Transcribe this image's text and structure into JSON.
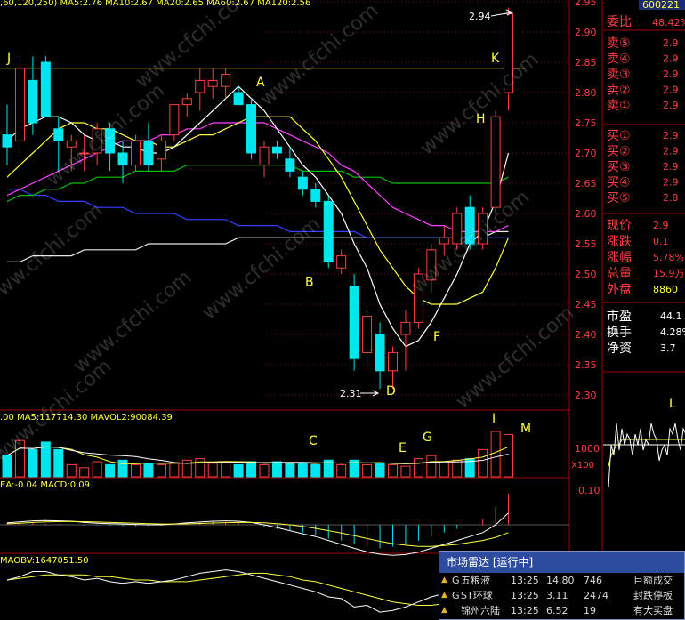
{
  "chart_data": [
    {
      "type": "candlestick",
      "title": "",
      "ylim": [
        2.28,
        2.99
      ],
      "y_ticks": [
        "2.95",
        "2.90",
        "2.85",
        "2.80",
        "2.75",
        "2.70",
        "2.65",
        "2.60",
        "2.55",
        "2.50",
        "2.45",
        "2.40",
        "2.35",
        "2.30"
      ],
      "header_text": ",60,120,250)   MA5:2.76   MA10:2.67   MA20:2.65   MA60:2.67   MA120:2.56",
      "high_label": "2.94",
      "low_label": "2.31",
      "horizontal_line": 2.84,
      "annotations": [
        "J",
        "K",
        "A",
        "H",
        "B",
        "F",
        "D"
      ],
      "candles": [
        {
          "o": 2.73,
          "h": 2.78,
          "l": 2.68,
          "c": 2.71
        },
        {
          "o": 2.72,
          "h": 2.86,
          "l": 2.7,
          "c": 2.84
        },
        {
          "o": 2.82,
          "h": 2.86,
          "l": 2.73,
          "c": 2.75
        },
        {
          "o": 2.85,
          "h": 2.86,
          "l": 2.76,
          "c": 2.76
        },
        {
          "o": 2.74,
          "h": 2.76,
          "l": 2.67,
          "c": 2.72
        },
        {
          "o": 2.71,
          "h": 2.73,
          "l": 2.67,
          "c": 2.72
        },
        {
          "o": 2.7,
          "h": 2.73,
          "l": 2.67,
          "c": 2.7
        },
        {
          "o": 2.7,
          "h": 2.75,
          "l": 2.68,
          "c": 2.74
        },
        {
          "o": 2.74,
          "h": 2.75,
          "l": 2.67,
          "c": 2.7
        },
        {
          "o": 2.7,
          "h": 2.72,
          "l": 2.65,
          "c": 2.68
        },
        {
          "o": 2.68,
          "h": 2.73,
          "l": 2.67,
          "c": 2.72
        },
        {
          "o": 2.72,
          "h": 2.75,
          "l": 2.67,
          "c": 2.68
        },
        {
          "o": 2.69,
          "h": 2.73,
          "l": 2.67,
          "c": 2.72
        },
        {
          "o": 2.73,
          "h": 2.78,
          "l": 2.72,
          "c": 2.78
        },
        {
          "o": 2.78,
          "h": 2.8,
          "l": 2.76,
          "c": 2.79
        },
        {
          "o": 2.8,
          "h": 2.84,
          "l": 2.77,
          "c": 2.82
        },
        {
          "o": 2.81,
          "h": 2.84,
          "l": 2.79,
          "c": 2.82
        },
        {
          "o": 2.81,
          "h": 2.84,
          "l": 2.79,
          "c": 2.83
        },
        {
          "o": 2.8,
          "h": 2.81,
          "l": 2.78,
          "c": 2.78
        },
        {
          "o": 2.78,
          "h": 2.79,
          "l": 2.69,
          "c": 2.7
        },
        {
          "o": 2.68,
          "h": 2.72,
          "l": 2.66,
          "c": 2.71
        },
        {
          "o": 2.71,
          "h": 2.72,
          "l": 2.69,
          "c": 2.7
        },
        {
          "o": 2.69,
          "h": 2.71,
          "l": 2.66,
          "c": 2.67
        },
        {
          "o": 2.66,
          "h": 2.67,
          "l": 2.63,
          "c": 2.64
        },
        {
          "o": 2.64,
          "h": 2.65,
          "l": 2.61,
          "c": 2.62
        },
        {
          "o": 2.62,
          "h": 2.63,
          "l": 2.51,
          "c": 2.52
        },
        {
          "o": 2.51,
          "h": 2.54,
          "l": 2.5,
          "c": 2.53
        },
        {
          "o": 2.48,
          "h": 2.5,
          "l": 2.34,
          "c": 2.36
        },
        {
          "o": 2.37,
          "h": 2.44,
          "l": 2.35,
          "c": 2.43
        },
        {
          "o": 2.4,
          "h": 2.42,
          "l": 2.31,
          "c": 2.34
        },
        {
          "o": 2.34,
          "h": 2.38,
          "l": 2.31,
          "c": 2.37
        },
        {
          "o": 2.4,
          "h": 2.44,
          "l": 2.34,
          "c": 2.42
        },
        {
          "o": 2.42,
          "h": 2.51,
          "l": 2.41,
          "c": 2.5
        },
        {
          "o": 2.49,
          "h": 2.55,
          "l": 2.47,
          "c": 2.54
        },
        {
          "o": 2.55,
          "h": 2.58,
          "l": 2.53,
          "c": 2.56
        },
        {
          "o": 2.55,
          "h": 2.61,
          "l": 2.54,
          "c": 2.6
        },
        {
          "o": 2.61,
          "h": 2.63,
          "l": 2.54,
          "c": 2.55
        },
        {
          "o": 2.55,
          "h": 2.61,
          "l": 2.54,
          "c": 2.6
        },
        {
          "o": 2.61,
          "h": 2.77,
          "l": 2.6,
          "c": 2.76
        },
        {
          "o": 2.8,
          "h": 2.94,
          "l": 2.77,
          "c": 2.93
        }
      ],
      "ma": {
        "MA5": [
          2.72,
          2.74,
          2.75,
          2.76,
          2.76,
          2.75,
          2.73,
          2.72,
          2.72,
          2.71,
          2.71,
          2.7,
          2.7,
          2.71,
          2.73,
          2.75,
          2.77,
          2.79,
          2.81,
          2.79,
          2.77,
          2.74,
          2.71,
          2.68,
          2.66,
          2.63,
          2.6,
          2.55,
          2.51,
          2.45,
          2.41,
          2.38,
          2.39,
          2.42,
          2.46,
          2.5,
          2.55,
          2.57,
          2.62,
          2.7
        ],
        "MA10": [
          2.66,
          2.68,
          2.7,
          2.72,
          2.74,
          2.75,
          2.75,
          2.74,
          2.74,
          2.73,
          2.72,
          2.72,
          2.71,
          2.71,
          2.72,
          2.73,
          2.73,
          2.74,
          2.75,
          2.76,
          2.76,
          2.76,
          2.76,
          2.74,
          2.72,
          2.69,
          2.66,
          2.62,
          2.58,
          2.54,
          2.51,
          2.48,
          2.46,
          2.45,
          2.45,
          2.45,
          2.46,
          2.47,
          2.51,
          2.56
        ],
        "MA20": [
          2.63,
          2.64,
          2.65,
          2.66,
          2.67,
          2.68,
          2.69,
          2.7,
          2.71,
          2.72,
          2.72,
          2.72,
          2.73,
          2.73,
          2.74,
          2.74,
          2.75,
          2.75,
          2.75,
          2.75,
          2.75,
          2.74,
          2.73,
          2.72,
          2.71,
          2.7,
          2.68,
          2.67,
          2.65,
          2.63,
          2.61,
          2.6,
          2.59,
          2.58,
          2.58,
          2.57,
          2.57,
          2.57,
          2.57,
          2.58
        ],
        "MA60": [
          2.62,
          2.63,
          2.63,
          2.64,
          2.64,
          2.65,
          2.65,
          2.66,
          2.66,
          2.66,
          2.67,
          2.67,
          2.67,
          2.67,
          2.68,
          2.68,
          2.68,
          2.68,
          2.68,
          2.68,
          2.68,
          2.68,
          2.68,
          2.67,
          2.67,
          2.67,
          2.67,
          2.66,
          2.66,
          2.66,
          2.65,
          2.65,
          2.65,
          2.65,
          2.65,
          2.65,
          2.65,
          2.65,
          2.65,
          2.66
        ],
        "MA120": [
          2.64,
          2.64,
          2.63,
          2.63,
          2.62,
          2.62,
          2.62,
          2.61,
          2.61,
          2.61,
          2.6,
          2.6,
          2.6,
          2.6,
          2.59,
          2.59,
          2.59,
          2.59,
          2.58,
          2.58,
          2.58,
          2.58,
          2.57,
          2.57,
          2.57,
          2.57,
          2.57,
          2.57,
          2.56,
          2.56,
          2.56,
          2.56,
          2.56,
          2.56,
          2.56,
          2.56,
          2.56,
          2.56,
          2.56,
          2.56
        ],
        "MA250": [
          2.52,
          2.52,
          2.53,
          2.53,
          2.53,
          2.53,
          2.54,
          2.54,
          2.54,
          2.54,
          2.54,
          2.55,
          2.55,
          2.55,
          2.55,
          2.55,
          2.55,
          2.55,
          2.56,
          2.56,
          2.56,
          2.56,
          2.56,
          2.56,
          2.56,
          2.56,
          2.56,
          2.56,
          2.56,
          2.56,
          2.56,
          2.56,
          2.56,
          2.56,
          2.56,
          2.56,
          2.56,
          2.56,
          2.57,
          2.57
        ]
      },
      "colors": {
        "up": "#ff4040",
        "down": "#00e5ee",
        "MA5": "#ffffff",
        "MA10": "#ffff40",
        "MA20": "#ff40ff",
        "MA60": "#00c000",
        "MA120": "#3040ff",
        "MA250": "#e8e8e8",
        "hline": "#c8c800"
      }
    },
    {
      "type": "bar",
      "title": "VOL",
      "header_text": ".00   MA5:117714.30   MAVOL2:90084.39",
      "y_tick": "1000",
      "y_unit": "X100",
      "annotations": [
        "C",
        "E",
        "G",
        "I",
        "M"
      ],
      "values": [
        70,
        120,
        90,
        115,
        90,
        40,
        30,
        50,
        40,
        55,
        40,
        45,
        40,
        45,
        55,
        60,
        45,
        50,
        40,
        50,
        40,
        50,
        45,
        45,
        40,
        55,
        40,
        55,
        40,
        45,
        40,
        35,
        60,
        70,
        50,
        55,
        60,
        90,
        150,
        140
      ],
      "colors": {
        "up": "#ff4040",
        "down": "#00e5ee",
        "ma": "#ffff40",
        "ma2": "#ffffff"
      }
    },
    {
      "type": "macd",
      "header_text": "EA:-0.04   MACD:0.09",
      "y_tick": "0.10",
      "values": [
        0.01,
        0.012,
        0.01,
        0.006,
        0.004,
        0.0,
        -0.004,
        -0.003,
        -0.004,
        -0.006,
        -0.006,
        -0.007,
        -0.004,
        0.004,
        0.01,
        0.016,
        0.018,
        0.016,
        0.01,
        0.0,
        -0.01,
        -0.02,
        -0.03,
        -0.04,
        -0.05,
        -0.07,
        -0.08,
        -0.1,
        -0.11,
        -0.12,
        -0.11,
        -0.1,
        -0.08,
        -0.06,
        -0.04,
        -0.02,
        0.0,
        0.03,
        0.09,
        0.16
      ],
      "dif": [
        0.01,
        0.015,
        0.02,
        0.022,
        0.02,
        0.018,
        0.012,
        0.008,
        0.006,
        0.004,
        0.002,
        0.0,
        0.0,
        0.004,
        0.01,
        0.014,
        0.018,
        0.02,
        0.018,
        0.012,
        0.0,
        -0.014,
        -0.03,
        -0.046,
        -0.06,
        -0.08,
        -0.1,
        -0.12,
        -0.138,
        -0.15,
        -0.156,
        -0.152,
        -0.14,
        -0.12,
        -0.1,
        -0.08,
        -0.06,
        -0.04,
        0.0,
        0.06
      ],
      "dea": [
        0.005,
        0.008,
        0.012,
        0.015,
        0.016,
        0.017,
        0.016,
        0.014,
        0.012,
        0.01,
        0.008,
        0.006,
        0.004,
        0.004,
        0.005,
        0.007,
        0.009,
        0.011,
        0.012,
        0.012,
        0.01,
        0.006,
        0.0,
        -0.008,
        -0.018,
        -0.03,
        -0.042,
        -0.056,
        -0.07,
        -0.084,
        -0.096,
        -0.104,
        -0.11,
        -0.11,
        -0.106,
        -0.1,
        -0.09,
        -0.08,
        -0.064,
        -0.04
      ],
      "colors": {
        "pos": "#ff4040",
        "neg": "#00e5ee",
        "dif": "#ffffff",
        "dea": "#ffff40"
      }
    },
    {
      "type": "line",
      "header_text": "MAOBV:1647051.50",
      "values": [
        90,
        92,
        95,
        95,
        93,
        92,
        90,
        91,
        89,
        88,
        89,
        88,
        89,
        90,
        92,
        94,
        95,
        96,
        95,
        93,
        91,
        89,
        87,
        85,
        83,
        80,
        79,
        74,
        75,
        71,
        72,
        74,
        77,
        80,
        82,
        85,
        83,
        85,
        92,
        100
      ],
      "ma": [
        90,
        91,
        92,
        93,
        93,
        93,
        93,
        92,
        92,
        91,
        90,
        90,
        89,
        89,
        89,
        90,
        91,
        92,
        93,
        94,
        94,
        93,
        92,
        90,
        89,
        87,
        85,
        83,
        81,
        79,
        77,
        76,
        75,
        75,
        76,
        77,
        78,
        80,
        82,
        85
      ],
      "colors": {
        "line": "#ffffff",
        "ma": "#ffff40"
      }
    },
    {
      "type": "intraday",
      "mini_label": "L",
      "values": [
        2.72,
        2.8,
        2.78,
        2.84,
        2.79,
        2.83,
        2.8,
        2.82,
        2.81,
        2.78,
        2.82,
        2.8,
        2.83,
        2.79,
        2.81,
        2.8,
        2.84,
        2.82,
        2.81,
        2.77,
        2.79,
        2.8,
        2.78,
        2.83,
        2.82,
        2.84,
        2.81,
        2.79,
        2.83,
        2.82
      ],
      "avg_values": [
        2.76,
        2.78,
        2.79,
        2.8,
        2.8,
        2.81,
        2.81,
        2.81,
        2.81,
        2.81,
        2.81,
        2.81,
        2.81,
        2.81,
        2.81,
        2.81,
        2.81,
        2.81,
        2.81,
        2.81,
        2.81,
        2.81,
        2.81,
        2.81,
        2.81,
        2.81,
        2.81,
        2.81,
        2.81,
        2.81
      ],
      "colors": {
        "line": "#ffffff",
        "avg": "#ffff40",
        "ref": "#ffffff"
      }
    }
  ],
  "quote": {
    "code": "600221",
    "weibi_label": "委比",
    "weibi_value": "48.42%",
    "sell_labels": [
      "卖⑤",
      "卖④",
      "卖③",
      "卖②",
      "卖①"
    ],
    "sell_prices": [
      "2.9",
      "2.9",
      "2.9",
      "2.9",
      "2.9"
    ],
    "buy_labels": [
      "买①",
      "买②",
      "买③",
      "买④",
      "买⑤"
    ],
    "buy_prices": [
      "2.9",
      "2.9",
      "2.9",
      "2.9",
      "2.8"
    ],
    "stats": [
      {
        "label": "现价",
        "value": "2.9"
      },
      {
        "label": "涨跌",
        "value": "0.1"
      },
      {
        "label": "涨幅",
        "value": "5.78%"
      },
      {
        "label": "总量",
        "value": "15.9万"
      },
      {
        "label": "外盘",
        "value": "8860"
      }
    ],
    "stats2": [
      {
        "label": "市盈",
        "value": "44.1"
      },
      {
        "label": "换手",
        "value": "4.28%"
      },
      {
        "label": "净资",
        "value": "3.7"
      }
    ],
    "colors": {
      "up": "#ff4040",
      "label": "#ff4040",
      "value_red": "#ff4040",
      "value_yellow": "#ffff40"
    }
  },
  "radar": {
    "title": "市场雷达 [运行中]",
    "rows": [
      {
        "mark": "G",
        "name": "五粮液",
        "time": "13:25",
        "price": "14.80",
        "vol": "746",
        "event": "巨额成交"
      },
      {
        "mark": "G",
        "name": "ST环球",
        "time": "13:25",
        "price": "3.11",
        "vol": "2474",
        "event": "封跌停板"
      },
      {
        "mark": "",
        "name": "锦州六陆",
        "time": "13:25",
        "price": "6.52",
        "vol": "19",
        "event": "有大买盘"
      }
    ]
  },
  "watermark": "www.cfchi.com"
}
